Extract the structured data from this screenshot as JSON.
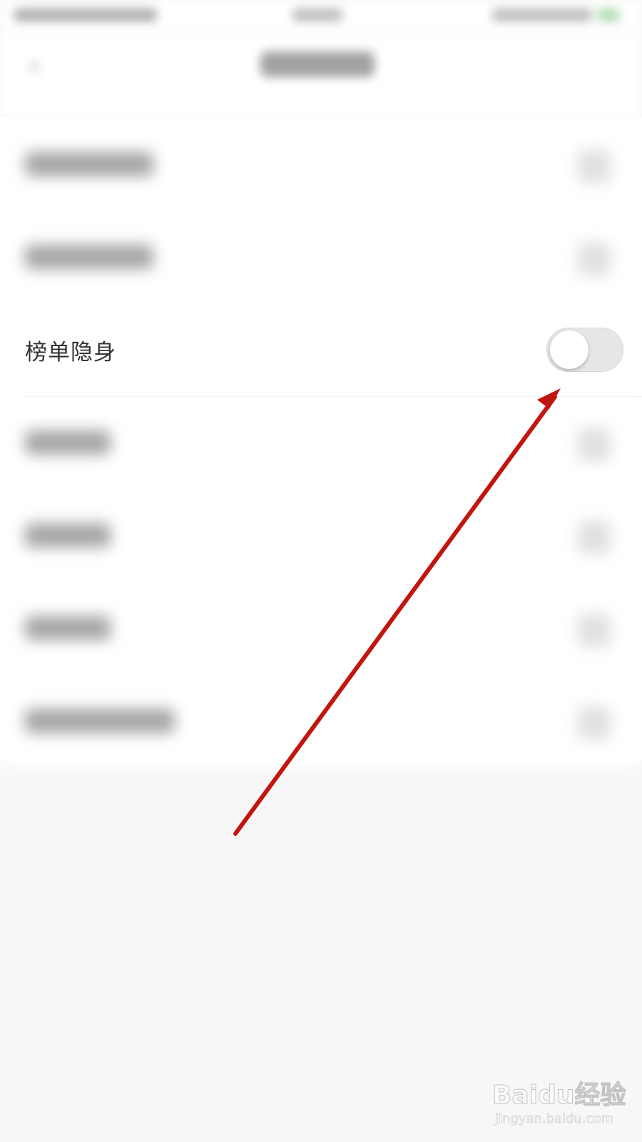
{
  "settings": {
    "focused_item": {
      "label": "榜单隐身",
      "toggle_state": "off"
    }
  },
  "colors": {
    "annotation_arrow": "#c0160f",
    "toggle_track_off": "#e6e6e6"
  },
  "watermark": {
    "logo_text": "Baidu经验",
    "url_text": "jingyan.baidu.com"
  }
}
